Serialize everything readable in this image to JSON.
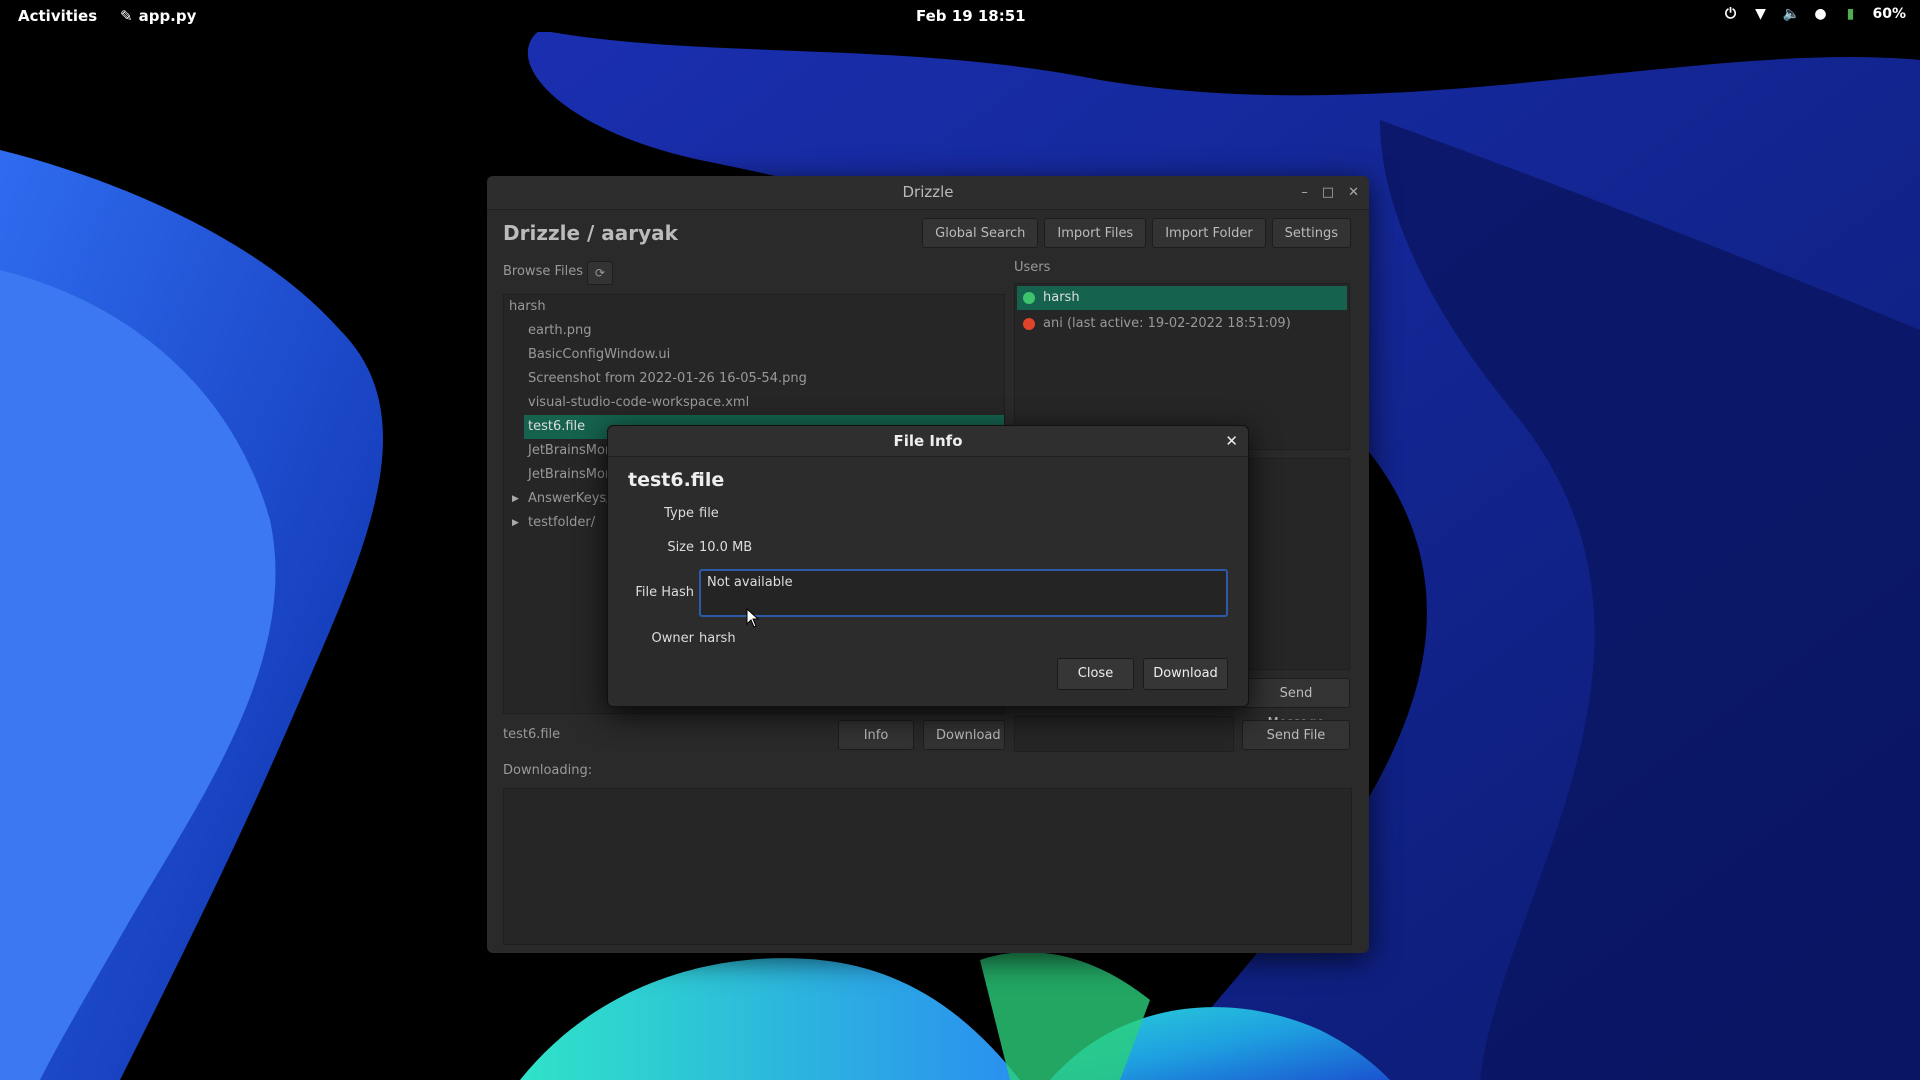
{
  "topbar": {
    "activities": "Activities",
    "app_name": "app.py",
    "clock": "Feb 19  18:51",
    "battery": "60%"
  },
  "window": {
    "title": "Drizzle",
    "header_title": "Drizzle / aaryak",
    "buttons": {
      "global_search": "Global Search",
      "import_files": "Import Files",
      "import_folder": "Import Folder",
      "settings": "Settings"
    },
    "browse_label": "Browse Files",
    "users_label": "Users",
    "tree": {
      "root": "harsh",
      "items": [
        "earth.png",
        "BasicConfigWindow.ui",
        "Screenshot from 2022-01-26 16-05-54.png",
        "visual-studio-code-workspace.xml",
        "test6.file",
        "JetBrainsMor",
        "JetBrainsMor",
        "AnswerKeys/",
        "testfolder/"
      ]
    },
    "users": [
      {
        "label": "harsh",
        "status_color": "#3ec46d"
      },
      {
        "label": "ani (last active: 19-02-2022 18:51:09)",
        "status_color": "#e0452b"
      }
    ],
    "send_message": "Send Message",
    "send_file": "Send File",
    "selected_file": "test6.file",
    "info_button": "Info",
    "download_button": "Download",
    "downloading_label": "Downloading:"
  },
  "dialog": {
    "title": "File Info",
    "filename": "test6.file",
    "type_label": "Type",
    "type_value": "file",
    "size_label": "Size",
    "size_value": "10.0 MB",
    "hash_label": "File Hash",
    "hash_value": "Not available",
    "owner_label": "Owner",
    "owner_value": "harsh",
    "close_button": "Close",
    "download_button": "Download"
  },
  "colors": {
    "accent_selection": "#15634f",
    "focus_border": "#2c5aa8"
  }
}
